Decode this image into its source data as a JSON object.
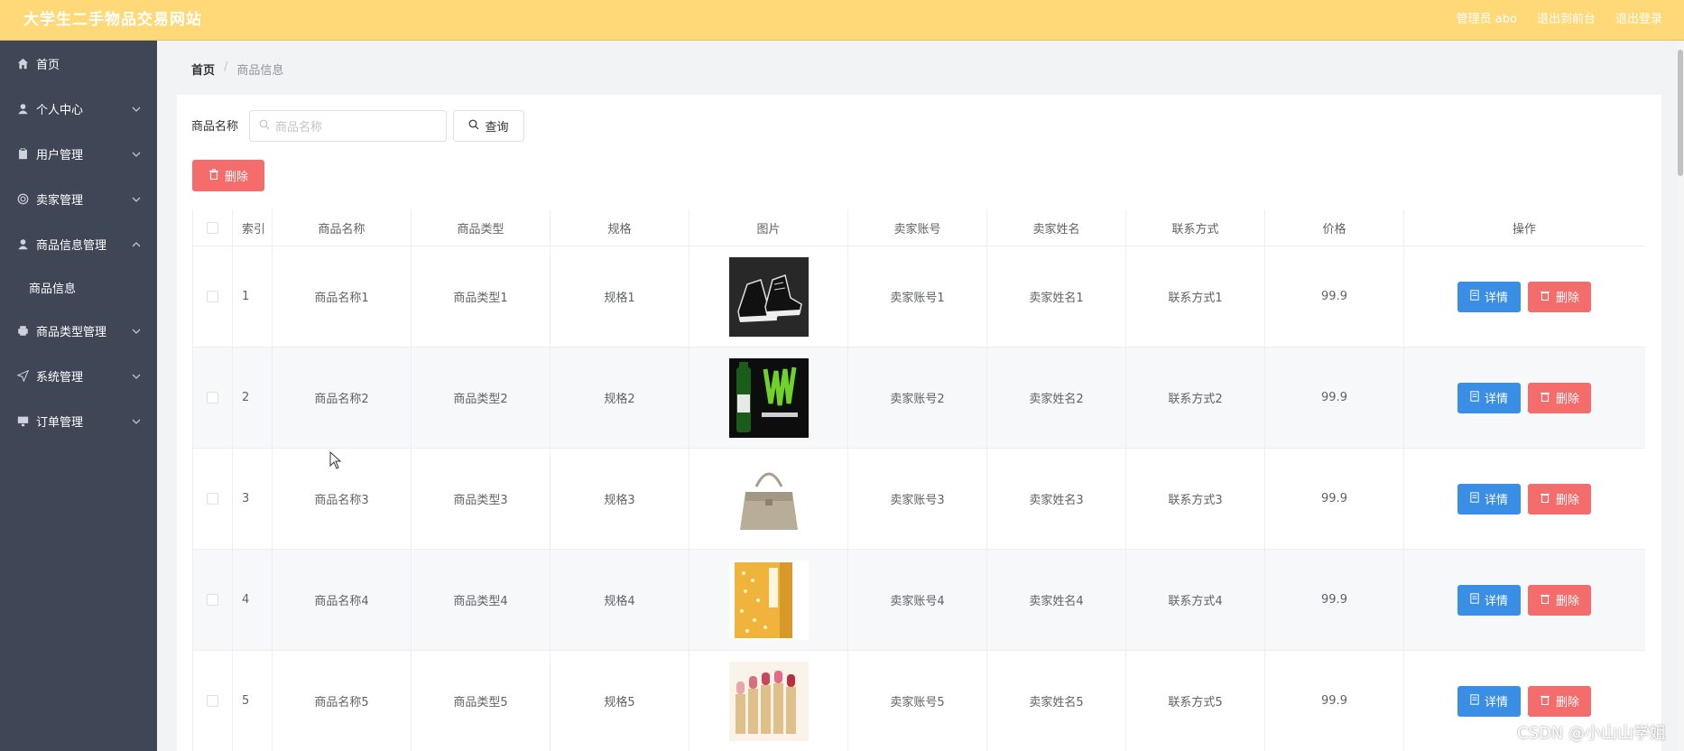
{
  "header": {
    "site_title": "大学生二手物品交易网站",
    "admin_label": "管理员 abo",
    "back_front": "退出到前台",
    "logout": "退出登录"
  },
  "sidebar": {
    "items": [
      {
        "label": "首页",
        "icon": "home-icon",
        "has_children": false
      },
      {
        "label": "个人中心",
        "icon": "user-icon",
        "has_children": true
      },
      {
        "label": "用户管理",
        "icon": "clipboard-icon",
        "has_children": true
      },
      {
        "label": "卖家管理",
        "icon": "settings-icon",
        "has_children": true
      },
      {
        "label": "商品信息管理",
        "icon": "user-icon",
        "has_children": true,
        "expanded": true,
        "children": [
          "商品信息"
        ]
      },
      {
        "label": "商品类型管理",
        "icon": "printer-icon",
        "has_children": true
      },
      {
        "label": "系统管理",
        "icon": "send-icon",
        "has_children": true
      },
      {
        "label": "订单管理",
        "icon": "monitor-icon",
        "has_children": true
      }
    ]
  },
  "breadcrumb": {
    "home": "首页",
    "separator": "/",
    "current": "商品信息"
  },
  "search": {
    "label": "商品名称",
    "placeholder": "商品名称",
    "query_button": "查询"
  },
  "toolbar": {
    "delete_button": "删除"
  },
  "table": {
    "headers": [
      "索引",
      "商品名称",
      "商品类型",
      "规格",
      "图片",
      "卖家账号",
      "卖家姓名",
      "联系方式",
      "价格",
      "操作"
    ],
    "rows": [
      {
        "index": "1",
        "name": "商品名称1",
        "type": "商品类型1",
        "spec": "规格1",
        "image": "sneakers",
        "account": "卖家账号1",
        "seller": "卖家姓名1",
        "contact": "联系方式1",
        "price": "99.9"
      },
      {
        "index": "2",
        "name": "商品名称2",
        "type": "商品类型2",
        "spec": "规格2",
        "image": "energy-drink",
        "account": "卖家账号2",
        "seller": "卖家姓名2",
        "contact": "联系方式2",
        "price": "99.9"
      },
      {
        "index": "3",
        "name": "商品名称3",
        "type": "商品类型3",
        "spec": "规格3",
        "image": "handbag",
        "account": "卖家账号3",
        "seller": "卖家姓名3",
        "contact": "联系方式3",
        "price": "99.9"
      },
      {
        "index": "4",
        "name": "商品名称4",
        "type": "商品类型4",
        "spec": "规格4",
        "image": "book",
        "account": "卖家账号4",
        "seller": "卖家姓名4",
        "contact": "联系方式4",
        "price": "99.9"
      },
      {
        "index": "5",
        "name": "商品名称5",
        "type": "商品类型5",
        "spec": "规格5",
        "image": "lipsticks",
        "account": "卖家账号5",
        "seller": "卖家姓名5",
        "contact": "联系方式5",
        "price": "99.9"
      }
    ],
    "detail_label": "详情",
    "delete_label": "删除"
  },
  "watermark": "CSDN @小山山学姐",
  "colors": {
    "header": "#ffd877",
    "sidebar": "#3f4656",
    "primary": "#3a8ee6",
    "danger": "#f56c6c"
  }
}
